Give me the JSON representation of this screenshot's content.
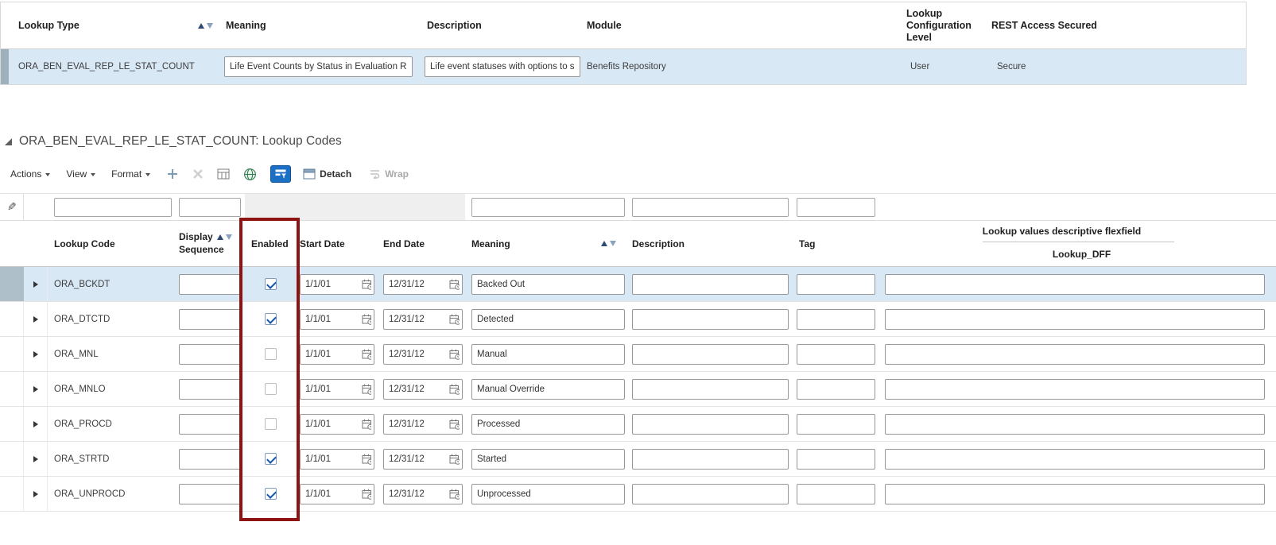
{
  "colors": {
    "annotation_box": "#8E1414",
    "selected_row": "#D9E8F5",
    "qbe_active_button": "#1B6FC4"
  },
  "icons": {
    "pencil": "✎"
  },
  "lookup_types": {
    "headers": {
      "lookup_type": "Lookup Type",
      "meaning": "Meaning",
      "description": "Description",
      "module": "Module",
      "configuration_level": "Lookup Configuration Level",
      "rest_access": "REST Access Secured"
    },
    "row": {
      "lookup_type": "ORA_BEN_EVAL_REP_LE_STAT_COUNT",
      "meaning": "Life Event Counts by Status in Evaluation R",
      "description": "Life event statuses with options to s",
      "module": "Benefits Repository",
      "configuration_level": "User",
      "rest_access": "Secure"
    }
  },
  "lookup_codes": {
    "section_title": "ORA_BEN_EVAL_REP_LE_STAT_COUNT: Lookup Codes",
    "toolbar": {
      "actions_label": "Actions",
      "view_label": "View",
      "format_label": "Format",
      "detach_label": "Detach",
      "wrap_label": "Wrap"
    },
    "qbe_filters": {
      "lookup_code": "",
      "display_sequence": "",
      "meaning": "",
      "description": "",
      "tag": ""
    },
    "headers": {
      "lookup_code": "Lookup Code",
      "display_sequence_line1": "Display",
      "display_sequence_line2": "Sequence",
      "enabled": "Enabled",
      "start_date": "Start Date",
      "end_date": "End Date",
      "meaning": "Meaning",
      "description": "Description",
      "tag": "Tag",
      "dff_group": "Lookup values descriptive flexfield",
      "dff_sub": "Lookup_DFF"
    },
    "rows": [
      {
        "code": "ORA_BCKDT",
        "display_sequence": "",
        "enabled": true,
        "start_date": "1/1/01",
        "end_date": "12/31/12",
        "meaning": "Backed Out",
        "description": "",
        "tag": "",
        "dff": ""
      },
      {
        "code": "ORA_DTCTD",
        "display_sequence": "",
        "enabled": true,
        "start_date": "1/1/01",
        "end_date": "12/31/12",
        "meaning": "Detected",
        "description": "",
        "tag": "",
        "dff": ""
      },
      {
        "code": "ORA_MNL",
        "display_sequence": "",
        "enabled": false,
        "start_date": "1/1/01",
        "end_date": "12/31/12",
        "meaning": "Manual",
        "description": "",
        "tag": "",
        "dff": ""
      },
      {
        "code": "ORA_MNLO",
        "display_sequence": "",
        "enabled": false,
        "start_date": "1/1/01",
        "end_date": "12/31/12",
        "meaning": "Manual Override",
        "description": "",
        "tag": "",
        "dff": ""
      },
      {
        "code": "ORA_PROCD",
        "display_sequence": "",
        "enabled": false,
        "start_date": "1/1/01",
        "end_date": "12/31/12",
        "meaning": "Processed",
        "description": "",
        "tag": "",
        "dff": ""
      },
      {
        "code": "ORA_STRTD",
        "display_sequence": "",
        "enabled": true,
        "start_date": "1/1/01",
        "end_date": "12/31/12",
        "meaning": "Started",
        "description": "",
        "tag": "",
        "dff": ""
      },
      {
        "code": "ORA_UNPROCD",
        "display_sequence": "",
        "enabled": true,
        "start_date": "1/1/01",
        "end_date": "12/31/12",
        "meaning": "Unprocessed",
        "description": "",
        "tag": "",
        "dff": ""
      }
    ]
  }
}
